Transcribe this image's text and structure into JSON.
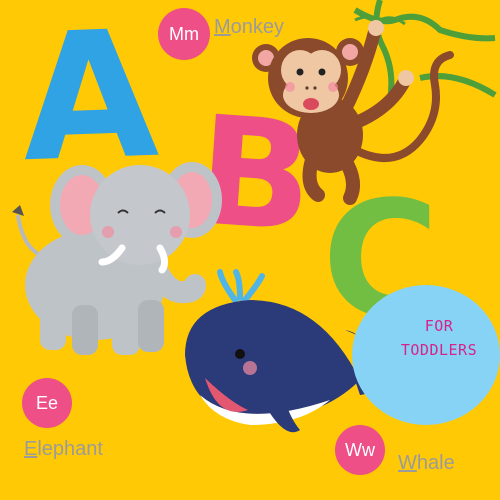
{
  "letters": {
    "a": "A",
    "b": "B",
    "c": "C"
  },
  "badges": {
    "monkey": {
      "letters": "Mm",
      "word_first": "M",
      "word_rest": "onkey"
    },
    "elephant": {
      "letters": "Ee",
      "word_first": "E",
      "word_rest": "lephant"
    },
    "whale": {
      "letters": "Ww",
      "word_first": "W",
      "word_rest": "hale"
    }
  },
  "tagline": {
    "line1": "FOR",
    "line2": "TODDLERS"
  },
  "colors": {
    "background": "#FFC906",
    "letter_a": "#2FA3E3",
    "letter_b": "#EE4F86",
    "letter_c": "#71BE43",
    "badge": "#EE4F86",
    "tagline_circle": "#87D3F5",
    "tagline_text": "#D8228A"
  }
}
